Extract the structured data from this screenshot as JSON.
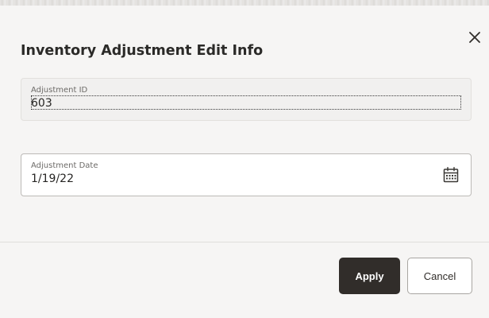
{
  "dialog": {
    "title": "Inventory Adjustment Edit Info",
    "close_icon": "close-icon"
  },
  "fields": {
    "adjustment_id": {
      "label": "Adjustment ID",
      "value": "603",
      "readonly": true
    },
    "adjustment_date": {
      "label": "Adjustment Date",
      "value": "1/19/22",
      "icon": "calendar-icon"
    }
  },
  "actions": {
    "apply_label": "Apply",
    "cancel_label": "Cancel"
  },
  "colors": {
    "background": "#f6f5f4",
    "primary_button": "#312d2a",
    "secondary_button": "#ffffff",
    "text": "#2b2a28"
  }
}
